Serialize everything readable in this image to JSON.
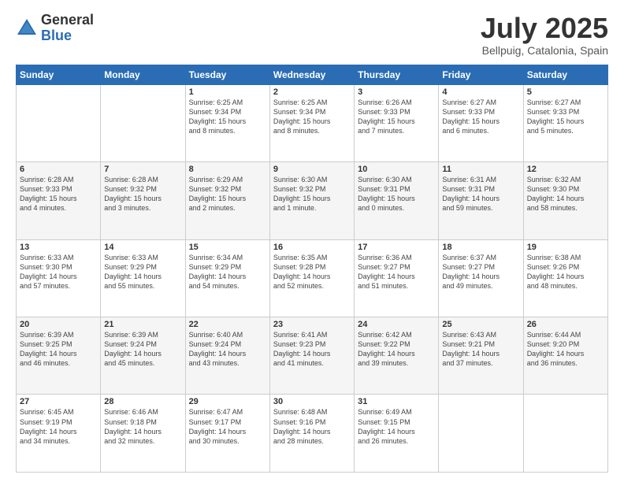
{
  "header": {
    "logo": {
      "general": "General",
      "blue": "Blue"
    },
    "title": "July 2025",
    "location": "Bellpuig, Catalonia, Spain"
  },
  "weekdays": [
    "Sunday",
    "Monday",
    "Tuesday",
    "Wednesday",
    "Thursday",
    "Friday",
    "Saturday"
  ],
  "weeks": [
    [
      {
        "day": "",
        "info": ""
      },
      {
        "day": "",
        "info": ""
      },
      {
        "day": "1",
        "info": "Sunrise: 6:25 AM\nSunset: 9:34 PM\nDaylight: 15 hours\nand 8 minutes."
      },
      {
        "day": "2",
        "info": "Sunrise: 6:25 AM\nSunset: 9:34 PM\nDaylight: 15 hours\nand 8 minutes."
      },
      {
        "day": "3",
        "info": "Sunrise: 6:26 AM\nSunset: 9:33 PM\nDaylight: 15 hours\nand 7 minutes."
      },
      {
        "day": "4",
        "info": "Sunrise: 6:27 AM\nSunset: 9:33 PM\nDaylight: 15 hours\nand 6 minutes."
      },
      {
        "day": "5",
        "info": "Sunrise: 6:27 AM\nSunset: 9:33 PM\nDaylight: 15 hours\nand 5 minutes."
      }
    ],
    [
      {
        "day": "6",
        "info": "Sunrise: 6:28 AM\nSunset: 9:33 PM\nDaylight: 15 hours\nand 4 minutes."
      },
      {
        "day": "7",
        "info": "Sunrise: 6:28 AM\nSunset: 9:32 PM\nDaylight: 15 hours\nand 3 minutes."
      },
      {
        "day": "8",
        "info": "Sunrise: 6:29 AM\nSunset: 9:32 PM\nDaylight: 15 hours\nand 2 minutes."
      },
      {
        "day": "9",
        "info": "Sunrise: 6:30 AM\nSunset: 9:32 PM\nDaylight: 15 hours\nand 1 minute."
      },
      {
        "day": "10",
        "info": "Sunrise: 6:30 AM\nSunset: 9:31 PM\nDaylight: 15 hours\nand 0 minutes."
      },
      {
        "day": "11",
        "info": "Sunrise: 6:31 AM\nSunset: 9:31 PM\nDaylight: 14 hours\nand 59 minutes."
      },
      {
        "day": "12",
        "info": "Sunrise: 6:32 AM\nSunset: 9:30 PM\nDaylight: 14 hours\nand 58 minutes."
      }
    ],
    [
      {
        "day": "13",
        "info": "Sunrise: 6:33 AM\nSunset: 9:30 PM\nDaylight: 14 hours\nand 57 minutes."
      },
      {
        "day": "14",
        "info": "Sunrise: 6:33 AM\nSunset: 9:29 PM\nDaylight: 14 hours\nand 55 minutes."
      },
      {
        "day": "15",
        "info": "Sunrise: 6:34 AM\nSunset: 9:29 PM\nDaylight: 14 hours\nand 54 minutes."
      },
      {
        "day": "16",
        "info": "Sunrise: 6:35 AM\nSunset: 9:28 PM\nDaylight: 14 hours\nand 52 minutes."
      },
      {
        "day": "17",
        "info": "Sunrise: 6:36 AM\nSunset: 9:27 PM\nDaylight: 14 hours\nand 51 minutes."
      },
      {
        "day": "18",
        "info": "Sunrise: 6:37 AM\nSunset: 9:27 PM\nDaylight: 14 hours\nand 49 minutes."
      },
      {
        "day": "19",
        "info": "Sunrise: 6:38 AM\nSunset: 9:26 PM\nDaylight: 14 hours\nand 48 minutes."
      }
    ],
    [
      {
        "day": "20",
        "info": "Sunrise: 6:39 AM\nSunset: 9:25 PM\nDaylight: 14 hours\nand 46 minutes."
      },
      {
        "day": "21",
        "info": "Sunrise: 6:39 AM\nSunset: 9:24 PM\nDaylight: 14 hours\nand 45 minutes."
      },
      {
        "day": "22",
        "info": "Sunrise: 6:40 AM\nSunset: 9:24 PM\nDaylight: 14 hours\nand 43 minutes."
      },
      {
        "day": "23",
        "info": "Sunrise: 6:41 AM\nSunset: 9:23 PM\nDaylight: 14 hours\nand 41 minutes."
      },
      {
        "day": "24",
        "info": "Sunrise: 6:42 AM\nSunset: 9:22 PM\nDaylight: 14 hours\nand 39 minutes."
      },
      {
        "day": "25",
        "info": "Sunrise: 6:43 AM\nSunset: 9:21 PM\nDaylight: 14 hours\nand 37 minutes."
      },
      {
        "day": "26",
        "info": "Sunrise: 6:44 AM\nSunset: 9:20 PM\nDaylight: 14 hours\nand 36 minutes."
      }
    ],
    [
      {
        "day": "27",
        "info": "Sunrise: 6:45 AM\nSunset: 9:19 PM\nDaylight: 14 hours\nand 34 minutes."
      },
      {
        "day": "28",
        "info": "Sunrise: 6:46 AM\nSunset: 9:18 PM\nDaylight: 14 hours\nand 32 minutes."
      },
      {
        "day": "29",
        "info": "Sunrise: 6:47 AM\nSunset: 9:17 PM\nDaylight: 14 hours\nand 30 minutes."
      },
      {
        "day": "30",
        "info": "Sunrise: 6:48 AM\nSunset: 9:16 PM\nDaylight: 14 hours\nand 28 minutes."
      },
      {
        "day": "31",
        "info": "Sunrise: 6:49 AM\nSunset: 9:15 PM\nDaylight: 14 hours\nand 26 minutes."
      },
      {
        "day": "",
        "info": ""
      },
      {
        "day": "",
        "info": ""
      }
    ]
  ]
}
